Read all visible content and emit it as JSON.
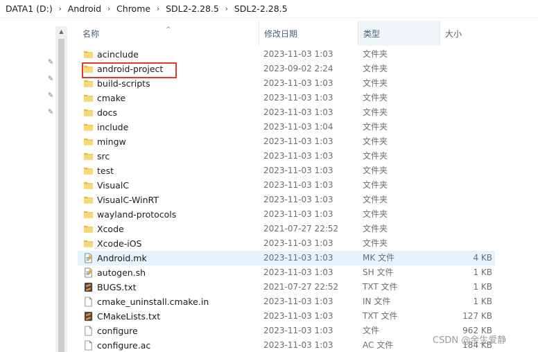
{
  "breadcrumb": [
    "DATA1 (D:)",
    "Android",
    "Chrome",
    "SDL2-2.28.5",
    "SDL2-2.28.5"
  ],
  "columns": {
    "name": "名称",
    "date": "修改日期",
    "type": "类型",
    "size": "大小"
  },
  "files": [
    {
      "name": "acinclude",
      "date": "2023-11-03 1:03",
      "type": "文件夹",
      "size": "",
      "icon": "folder-icon"
    },
    {
      "name": "android-project",
      "date": "2023-09-02 2:24",
      "type": "文件夹",
      "size": "",
      "icon": "folder-icon"
    },
    {
      "name": "build-scripts",
      "date": "2023-11-03 1:03",
      "type": "文件夹",
      "size": "",
      "icon": "folder-icon"
    },
    {
      "name": "cmake",
      "date": "2023-11-03 1:03",
      "type": "文件夹",
      "size": "",
      "icon": "folder-icon"
    },
    {
      "name": "docs",
      "date": "2023-11-03 1:03",
      "type": "文件夹",
      "size": "",
      "icon": "folder-icon"
    },
    {
      "name": "include",
      "date": "2023-11-03 1:04",
      "type": "文件夹",
      "size": "",
      "icon": "folder-icon"
    },
    {
      "name": "mingw",
      "date": "2023-11-03 1:03",
      "type": "文件夹",
      "size": "",
      "icon": "folder-icon"
    },
    {
      "name": "src",
      "date": "2023-11-03 1:03",
      "type": "文件夹",
      "size": "",
      "icon": "folder-icon"
    },
    {
      "name": "test",
      "date": "2023-11-03 1:03",
      "type": "文件夹",
      "size": "",
      "icon": "folder-icon"
    },
    {
      "name": "VisualC",
      "date": "2023-11-03 1:03",
      "type": "文件夹",
      "size": "",
      "icon": "folder-icon"
    },
    {
      "name": "VisualC-WinRT",
      "date": "2023-11-03 1:03",
      "type": "文件夹",
      "size": "",
      "icon": "folder-icon"
    },
    {
      "name": "wayland-protocols",
      "date": "2023-11-03 1:03",
      "type": "文件夹",
      "size": "",
      "icon": "folder-icon"
    },
    {
      "name": "Xcode",
      "date": "2021-07-27 22:52",
      "type": "文件夹",
      "size": "",
      "icon": "folder-icon"
    },
    {
      "name": "Xcode-iOS",
      "date": "2023-11-03 1:03",
      "type": "文件夹",
      "size": "",
      "icon": "folder-icon"
    },
    {
      "name": "Android.mk",
      "date": "2023-11-03 1:03",
      "type": "MK 文件",
      "size": "4 KB",
      "icon": "script-file-icon"
    },
    {
      "name": "autogen.sh",
      "date": "2023-11-03 1:03",
      "type": "SH 文件",
      "size": "1 KB",
      "icon": "script-file-icon"
    },
    {
      "name": "BUGS.txt",
      "date": "2021-07-27 22:52",
      "type": "TXT 文件",
      "size": "1 KB",
      "icon": "sublime-file-icon"
    },
    {
      "name": "cmake_uninstall.cmake.in",
      "date": "2023-11-03 1:03",
      "type": "IN 文件",
      "size": "1 KB",
      "icon": "blank-file-icon"
    },
    {
      "name": "CMakeLists.txt",
      "date": "2023-11-03 1:03",
      "type": "TXT 文件",
      "size": "127 KB",
      "icon": "sublime-file-icon"
    },
    {
      "name": "configure",
      "date": "2023-11-03 1:03",
      "type": "文件",
      "size": "962 KB",
      "icon": "blank-file-icon"
    },
    {
      "name": "configure.ac",
      "date": "2023-11-03 1:03",
      "type": "AC 文件",
      "size": "184 KB",
      "icon": "blank-file-icon"
    }
  ],
  "hovered_row": "Android.mk",
  "highlighted_row": "android-project",
  "watermark": "CSDN @余生爱静",
  "colors": {
    "folder": "#f8d775",
    "highlight": "#e0352b",
    "hover": "#e5f3ff",
    "sublime": "#f08a24"
  }
}
